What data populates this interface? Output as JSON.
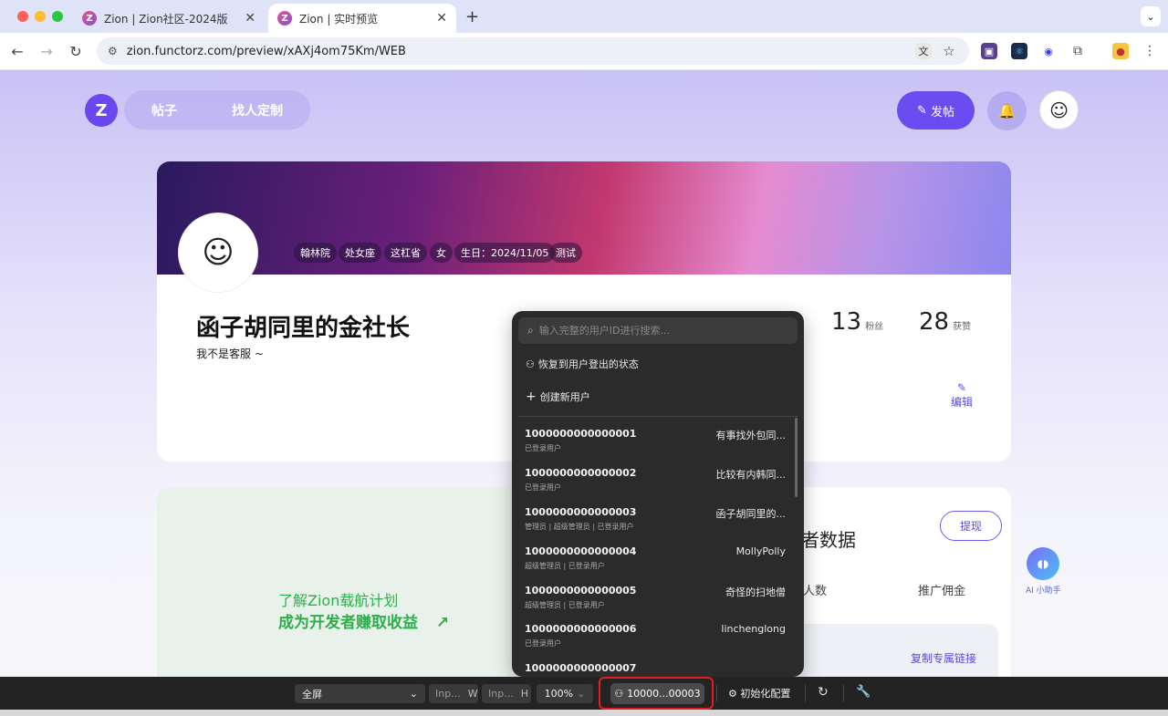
{
  "browser": {
    "tabs": [
      {
        "title": "Zion | Zion社区-2024版",
        "active": false
      },
      {
        "title": "Zion | 实时预览",
        "active": true
      }
    ],
    "url": "zion.functorz.com/preview/xAXj4om75Km/WEB"
  },
  "header": {
    "logo": "Z",
    "nav": [
      "帖子",
      "找人定制"
    ],
    "post_button": "发帖"
  },
  "profile": {
    "tags": [
      "翰林院",
      "处女座",
      "这杠省",
      "女",
      "生日：2024/11/05",
      "测试"
    ],
    "name": "函子胡同里的金社长",
    "bio": "我不是客服 ~",
    "stats": [
      {
        "value": "13",
        "label": "粉丝"
      },
      {
        "value": "28",
        "label": "获赞"
      }
    ],
    "edit_label": "编辑"
  },
  "promo": {
    "line1": "了解Zion载航计划",
    "line2": "成为开发者赚取收益",
    "arrow": "↗",
    "data_title": "者数据",
    "withdraw": "提现",
    "col_people": "人数",
    "col_commission": "推广佣金",
    "copy_link": "复制专属链接"
  },
  "ai_assistant": {
    "label": "AI 小助手"
  },
  "user_switcher": {
    "search_placeholder": "输入完整的用户ID进行搜索...",
    "restore_label": "恢复到用户登出的状态",
    "create_label": "创建新用户",
    "users": [
      {
        "id": "1000000000000001",
        "name": "有事找外包同...",
        "roles": "已登录用户"
      },
      {
        "id": "1000000000000002",
        "name": "比较有内韩同...",
        "roles": "已登录用户"
      },
      {
        "id": "1000000000000003",
        "name": "函子胡同里的...",
        "roles": "管理员 | 超级管理员 | 已登录用户"
      },
      {
        "id": "1000000000000004",
        "name": "MollyPolly",
        "roles": "超级管理员 | 已登录用户"
      },
      {
        "id": "1000000000000005",
        "name": "奇怪的扫地僧",
        "roles": "超级管理员 | 已登录用户"
      },
      {
        "id": "1000000000000006",
        "name": "linchenglong",
        "roles": "已登录用户"
      },
      {
        "id": "1000000000000007",
        "name": "",
        "roles": ""
      }
    ]
  },
  "toolbar": {
    "device_select": "全屏",
    "width_input": "Inp...",
    "width_label": "W",
    "height_input": "Inp...",
    "height_label": "H",
    "zoom": "100%",
    "current_user": "10000...00003",
    "init_config": "初始化配置"
  }
}
